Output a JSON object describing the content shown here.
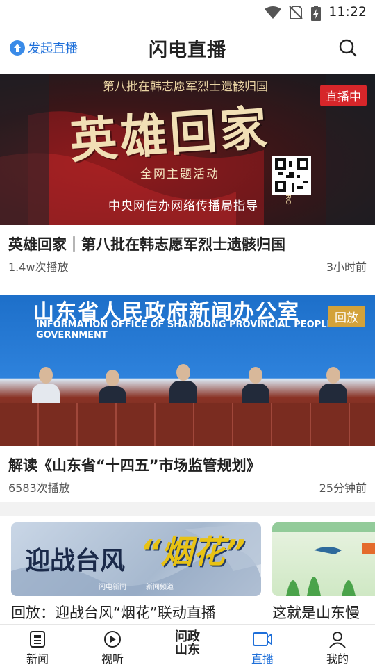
{
  "status_bar": {
    "time": "11:22",
    "icons": [
      "wifi-icon",
      "no-sim-icon",
      "battery-charging-icon"
    ]
  },
  "header": {
    "start_live_label": "发起直播",
    "title": "闪电直播",
    "search_icon": "search-icon"
  },
  "items": [
    {
      "image": {
        "line1": "第八批在韩志愿军烈士遗骸归国",
        "big": "英雄回家",
        "sub": "全网主题活动",
        "guide": "中央网信办网络传播局指导",
        "hero": "HERO"
      },
      "badge": "直播中",
      "badge_color": "#d6262a",
      "title": "英雄回家｜第八批在韩志愿军烈士遗骸归国",
      "plays": "1.4w次播放",
      "time": "3小时前"
    },
    {
      "image": {
        "cn": "山东省人民政府新闻办公室",
        "en": "INFORMATION OFFICE OF SHANDONG PROVINCIAL PEOPLE'S GOVERNMENT"
      },
      "badge": "回放",
      "badge_color": "#d3a23a",
      "title": "解读《山东省“十四五”市场监管规划》",
      "plays": "6583次播放",
      "time": "25分钟前"
    }
  ],
  "row": [
    {
      "image": {
        "t1": "迎战台风",
        "t2": "“烟花”",
        "logo1": "闪电新闻",
        "logo2": "新闻频道"
      },
      "caption": "回放：迎战台风“烟花”联动直播"
    },
    {
      "caption": "这就是山东慢"
    }
  ],
  "nav": [
    {
      "label": "新闻",
      "icon": "news-icon",
      "active": false
    },
    {
      "label": "视听",
      "icon": "play-circle-icon",
      "active": false
    },
    {
      "label": "问政山东",
      "icon": "wenzheng-logo-icon",
      "active": false
    },
    {
      "label": "直播",
      "icon": "live-tv-icon",
      "active": true
    },
    {
      "label": "我的",
      "icon": "profile-icon",
      "active": false
    }
  ],
  "colors": {
    "accent": "#1e6fd9"
  }
}
